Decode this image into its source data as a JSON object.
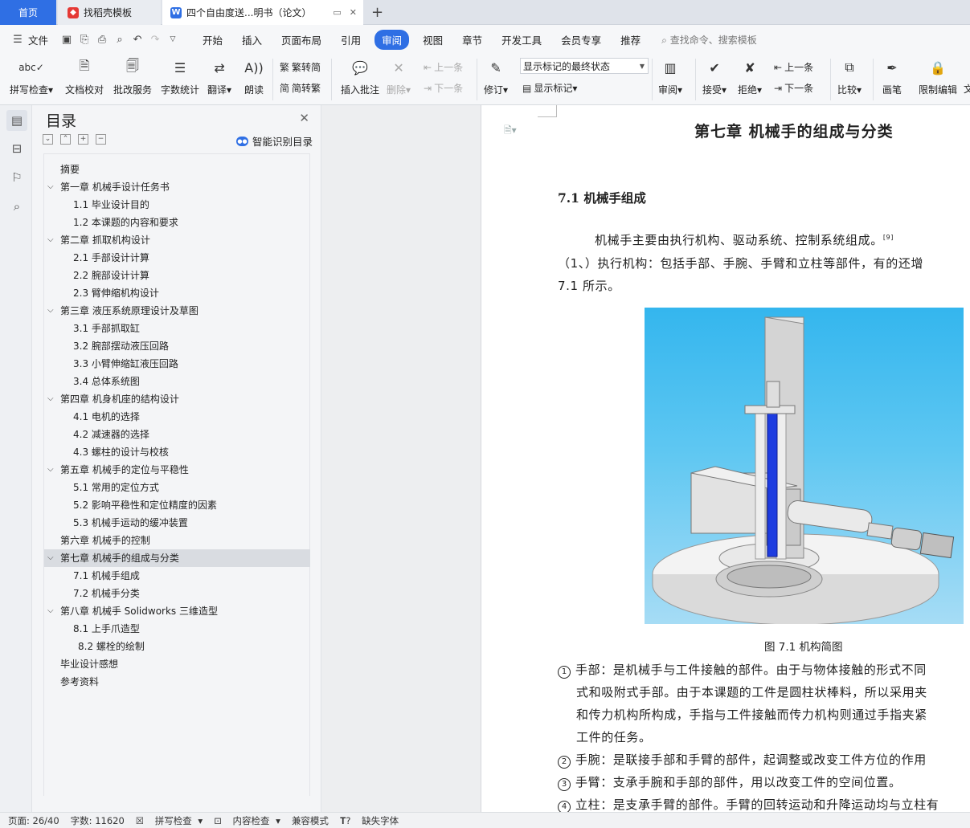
{
  "tabs": {
    "home": "首页",
    "tab2": "找稻壳模板",
    "tab3": "四个自由度送...明书（论文）",
    "new_tab": "+"
  },
  "menu": {
    "file": "文件",
    "items": [
      "开始",
      "插入",
      "页面布局",
      "引用",
      "审阅",
      "视图",
      "章节",
      "开发工具",
      "会员专享",
      "推荐"
    ],
    "active_index": 4,
    "search": "查找命令、搜索模板"
  },
  "ribbon": {
    "spell_check": "拼写检查",
    "doc_proof": "文档校对",
    "batch_service": "批改服务",
    "word_count": "字数统计",
    "translate": "翻译",
    "read_aloud": "朗读",
    "to_traditional": "繁转简",
    "to_simplified": "简转繁",
    "insert_comment": "插入批注",
    "delete": "删除",
    "prev": "上一条",
    "next": "下一条",
    "revise": "修订",
    "markup_combo": "显示标记的最终状态",
    "show_markup": "显示标记",
    "review": "审阅",
    "accept": "接受",
    "reject": "拒绝",
    "prev2": "上一条",
    "next2": "下一条",
    "compare": "比较",
    "pen": "画笔",
    "restrict": "限制编辑",
    "more": "文"
  },
  "toc": {
    "title": "目录",
    "smart": "智能识别目录",
    "items": [
      {
        "text": "摘要",
        "level": 0,
        "chev": false
      },
      {
        "text": "第一章  机械手设计任务书",
        "level": 0,
        "chev": true
      },
      {
        "text": "1.1 毕业设计目的",
        "level": 1,
        "chev": false
      },
      {
        "text": "1.2 本课题的内容和要求",
        "level": 1,
        "chev": false
      },
      {
        "text": "第二章  抓取机构设计",
        "level": 0,
        "chev": true
      },
      {
        "text": "2.1 手部设计计算",
        "level": 1,
        "chev": false
      },
      {
        "text": "2.2 腕部设计计算",
        "level": 1,
        "chev": false
      },
      {
        "text": "2.3 臂伸缩机构设计",
        "level": 1,
        "chev": false
      },
      {
        "text": "第三章  液压系统原理设计及草图",
        "level": 0,
        "chev": true
      },
      {
        "text": "3.1 手部抓取缸",
        "level": 1,
        "chev": false
      },
      {
        "text": "3.2 腕部摆动液压回路",
        "level": 1,
        "chev": false
      },
      {
        "text": "3.3 小臂伸缩缸液压回路",
        "level": 1,
        "chev": false
      },
      {
        "text": "3.4 总体系统图",
        "level": 1,
        "chev": false
      },
      {
        "text": "第四章  机身机座的结构设计",
        "level": 0,
        "chev": true
      },
      {
        "text": "4.1 电机的选择",
        "level": 1,
        "chev": false
      },
      {
        "text": "4.2 减速器的选择",
        "level": 1,
        "chev": false
      },
      {
        "text": "4.3 螺柱的设计与校核",
        "level": 1,
        "chev": false
      },
      {
        "text": "第五章  机械手的定位与平稳性",
        "level": 0,
        "chev": true
      },
      {
        "text": "5.1 常用的定位方式",
        "level": 1,
        "chev": false
      },
      {
        "text": "5.2 影响平稳性和定位精度的因素",
        "level": 1,
        "chev": false
      },
      {
        "text": "5.3 机械手运动的缓冲装置",
        "level": 1,
        "chev": false
      },
      {
        "text": "第六章  机械手的控制",
        "level": 0,
        "chev": false
      },
      {
        "text": "第七章  机械手的组成与分类",
        "level": 0,
        "chev": true,
        "selected": true
      },
      {
        "text": "7.1 机械手组成",
        "level": 1,
        "chev": false
      },
      {
        "text": "7.2 机械手分类",
        "level": 1,
        "chev": false
      },
      {
        "text": "第八章  机械手 Solidworks 三维造型",
        "level": 0,
        "chev": true
      },
      {
        "text": "8.1 上手爪造型",
        "level": 1,
        "chev": false
      },
      {
        "text": "8.2 螺栓的绘制",
        "level": 2,
        "chev": false
      },
      {
        "text": "毕业设计感想",
        "level": 0,
        "chev": false
      },
      {
        "text": "参考资料",
        "level": 0,
        "chev": false
      }
    ]
  },
  "doc": {
    "chapter": "第七章  机械手的组成与分类",
    "section": "7.1 机械手组成",
    "p1": "机械手主要由执行机构、驱动系统、控制系统组成。",
    "p1_ref": "[9]",
    "p2": "（1、）执行机构：包括手部、手腕、手臂和立柱等部件，有的还增",
    "p3": "7.1 所示。",
    "caption": "图 7.1 机构简图",
    "items": [
      {
        "num": "1",
        "lines": [
          "手部：是机械手与工件接触的部件。由于与物体接触的形式不同",
          "式和吸附式手部。由于本课题的工件是圆柱状棒料，所以采用夹",
          "和传力机构所构成，手指与工件接触而传力机构则通过手指夹紧",
          "工件的任务。"
        ]
      },
      {
        "num": "2",
        "lines": [
          "手腕：是联接手部和手臂的部件，起调整或改变工件方位的作用"
        ]
      },
      {
        "num": "3",
        "lines": [
          "手臂：支承手腕和手部的部件，用以改变工件的空间位置。"
        ]
      },
      {
        "num": "4",
        "lines": [
          "立柱：是支承手臂的部件。手臂的回转运动和升降运动均与立柱有"
        ]
      }
    ]
  },
  "status": {
    "page": "页面: 26/40",
    "words": "字数: 11620",
    "spell": "拼写检查",
    "content": "内容检查",
    "compat": "兼容模式",
    "missing_font": "缺失字体"
  },
  "colors": {
    "accent": "#2f6fe4",
    "selected_toc": "#d9dce1",
    "sky": "#34b6ee"
  }
}
